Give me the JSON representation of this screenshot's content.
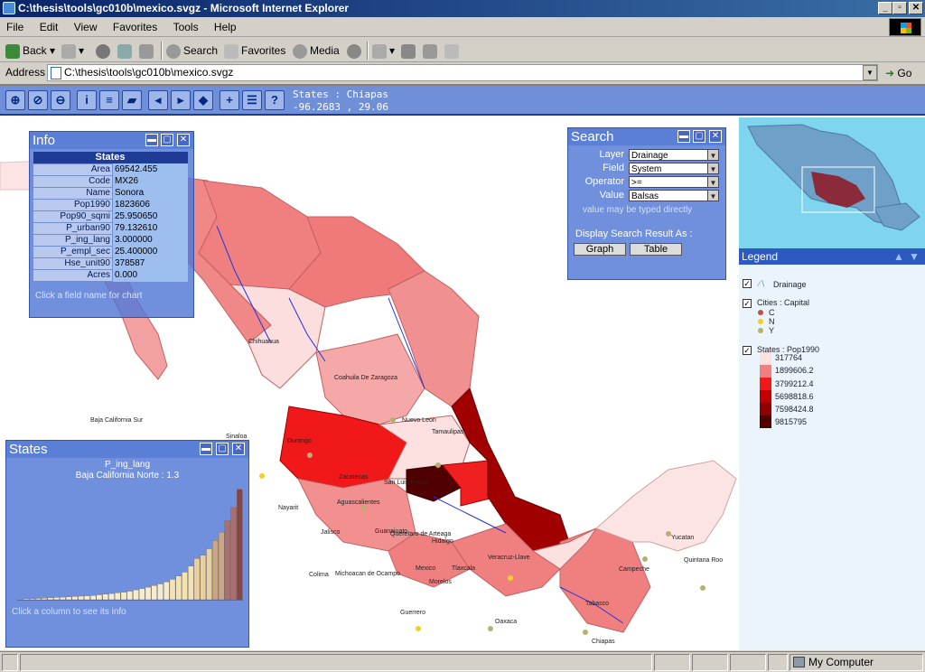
{
  "window": {
    "title": "C:\\thesis\\tools\\gc010b\\mexico.svgz - Microsoft Internet Explorer"
  },
  "menu": [
    "File",
    "Edit",
    "View",
    "Favorites",
    "Tools",
    "Help"
  ],
  "toolbar": {
    "back": "Back",
    "search": "Search",
    "favorites": "Favorites",
    "media": "Media"
  },
  "address": {
    "label": "Address",
    "url": "C:\\thesis\\tools\\gc010b\\mexico.svgz",
    "go": "Go"
  },
  "svg_status": {
    "line1": "States : Chiapas",
    "line2": "-96.2683 , 29.06"
  },
  "info_panel": {
    "title": "Info",
    "table_title": "States",
    "rows": [
      {
        "k": "Area",
        "v": "69542.455"
      },
      {
        "k": "Code",
        "v": "MX26"
      },
      {
        "k": "Name",
        "v": "Sonora"
      },
      {
        "k": "Pop1990",
        "v": "1823606"
      },
      {
        "k": "Pop90_sqmi",
        "v": "25.950650"
      },
      {
        "k": "P_urban90",
        "v": "79.132610"
      },
      {
        "k": "P_ing_lang",
        "v": "3.000000"
      },
      {
        "k": "P_empl_sec",
        "v": "25.400000"
      },
      {
        "k": "Hse_unit90",
        "v": "378587"
      },
      {
        "k": "Acres",
        "v": "0.000"
      }
    ],
    "hint": "Click a field name for chart"
  },
  "search_panel": {
    "title": "Search",
    "fields": [
      {
        "label": "Layer",
        "value": "Drainage"
      },
      {
        "label": "Field",
        "value": "System"
      },
      {
        "label": "Operator",
        "value": ">="
      },
      {
        "label": "Value",
        "value": "Balsas"
      }
    ],
    "note": "value may be typed directly",
    "display_label": "Display Search Result As :",
    "graph": "Graph",
    "table": "Table"
  },
  "states_panel": {
    "title": "States",
    "field": "P_ing_lang",
    "selected": "Baja California Norte : 1.3",
    "hint": "Click a column to see its info"
  },
  "chart_data": {
    "type": "bar",
    "title": "P_ing_lang",
    "values": [
      0.2,
      0.3,
      0.3,
      0.4,
      0.5,
      0.6,
      0.7,
      0.8,
      0.9,
      1.0,
      1.1,
      1.2,
      1.3,
      1.5,
      1.7,
      1.9,
      2.1,
      2.3,
      2.6,
      3.0,
      3.4,
      3.8,
      4.3,
      4.8,
      5.4,
      6.2,
      7.2,
      8.4,
      10.2,
      12.5,
      13.5,
      15.5,
      18.0,
      20.5,
      24.0,
      28.0,
      33.5
    ],
    "ylim": [
      0,
      34
    ]
  },
  "legend": {
    "title": "Legend",
    "drainage": "Drainage",
    "cities_title": "Cities : Capital",
    "cities": [
      {
        "label": "C",
        "color": "#c0504d"
      },
      {
        "label": "N",
        "color": "#f0d020"
      },
      {
        "label": "Y",
        "color": "#b8b070"
      }
    ],
    "states_title": "States : Pop1990",
    "classes": [
      {
        "label": "317764",
        "color": "#fde0e0"
      },
      {
        "label": "1899606.2",
        "color": "#f08080"
      },
      {
        "label": "3799212.4",
        "color": "#f01818"
      },
      {
        "label": "5698818.6",
        "color": "#c00000"
      },
      {
        "label": "7598424.8",
        "color": "#900000"
      },
      {
        "label": "9815795",
        "color": "#500000"
      }
    ]
  },
  "map_labels": [
    {
      "t": "Chihuahua"
    },
    {
      "t": "Coahuila De Zaragoza"
    },
    {
      "t": "Baja California Sur"
    },
    {
      "t": "Sinaloa"
    },
    {
      "t": "Durango"
    },
    {
      "t": "Nuevo Leon"
    },
    {
      "t": "Tamaulipas"
    },
    {
      "t": "Zacatecas"
    },
    {
      "t": "San Luis Potosi"
    },
    {
      "t": "Nayarit"
    },
    {
      "t": "Aguascalientes"
    },
    {
      "t": "Jalisco"
    },
    {
      "t": "Guanajuato"
    },
    {
      "t": "Queretaro de Arteaga"
    },
    {
      "t": "Hidalgo"
    },
    {
      "t": "Veracruz-Llave"
    },
    {
      "t": "Colima"
    },
    {
      "t": "Michoacan de Ocampo"
    },
    {
      "t": "Mexico"
    },
    {
      "t": "Morelos"
    },
    {
      "t": "Tlaxcala"
    },
    {
      "t": "Guerrero"
    },
    {
      "t": "Oaxaca"
    },
    {
      "t": "Tabasco"
    },
    {
      "t": "Chiapas"
    },
    {
      "t": "Campeche"
    },
    {
      "t": "Yucatan"
    },
    {
      "t": "Quintana Roo"
    }
  ],
  "status": {
    "zone": "My Computer"
  }
}
